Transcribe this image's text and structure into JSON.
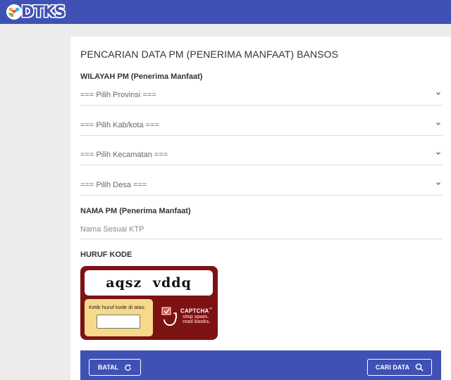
{
  "header": {
    "logo_text": "DTKS"
  },
  "form": {
    "title": "PENCARIAN DATA PM (PENERIMA MANFAAT) BANSOS",
    "wilayah_label": "WILAYAH PM (Penerima Manfaat)",
    "provinsi": "=== Pilih Provinsi ===",
    "kabkota": "=== Pilih Kab/kota ===",
    "kecamatan": "=== Pilih Kecamatan ===",
    "desa": "=== Pilih Desa ===",
    "nama_label": "NAMA PM (Penerima Manfaat)",
    "nama_placeholder": "Nama Sesuai KTP",
    "kode_label": "HURUF KODE"
  },
  "captcha": {
    "word": "aqsz vddq",
    "prompt": "Ketik huruf kode di atas:",
    "brand": "CAPTCHA",
    "trademark": "™",
    "tagline_1": "stop spam.",
    "tagline_2": "read books."
  },
  "actions": {
    "batal": "BATAL",
    "cari": "CARI DATA"
  },
  "colors": {
    "primary": "#3f51b5",
    "captcha_bg": "#7c1212",
    "captcha_entry": "#f7d98b"
  }
}
